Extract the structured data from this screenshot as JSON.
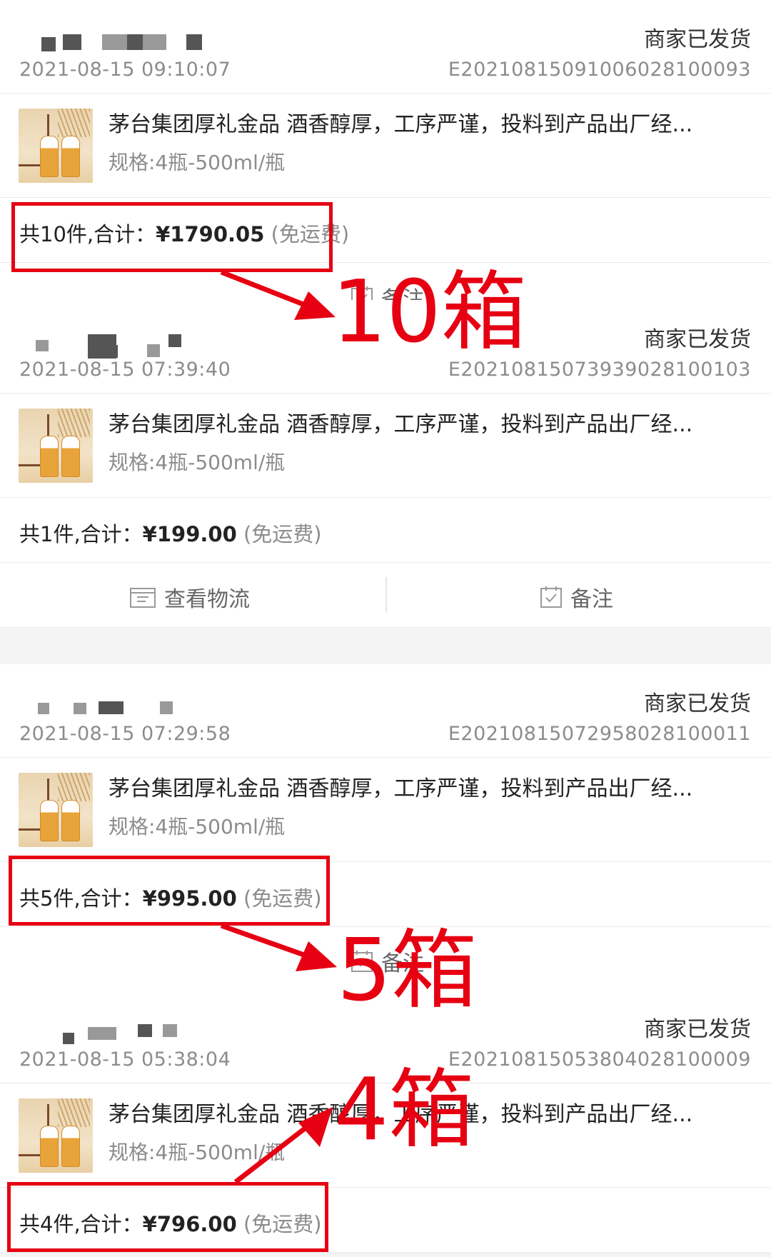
{
  "orders": [
    {
      "time": "2021-08-15 09:10:07",
      "status": "商家已发货",
      "order_no": "E20210815091006028100093",
      "product_title": "茅台集团厚礼金品 酒香醇厚，工序严谨，投料到产品出厂经...",
      "spec": "规格:4瓶-500ml/瓶",
      "total_prefix": "共10件,合计：",
      "amount": "¥1790.05",
      "shipping": "(免运费)",
      "action_note_label": "备注"
    },
    {
      "time": "2021-08-15 07:39:40",
      "status": "商家已发货",
      "order_no": "E20210815073939028100103",
      "product_title": "茅台集团厚礼金品 酒香醇厚，工序严谨，投料到产品出厂经...",
      "spec": "规格:4瓶-500ml/瓶",
      "total_prefix": "共1件,合计：",
      "amount": "¥199.00",
      "shipping": "(免运费)",
      "action_logistics_label": "查看物流",
      "action_note_label": "备注"
    },
    {
      "time": "2021-08-15 07:29:58",
      "status": "商家已发货",
      "order_no": "E20210815072958028100011",
      "product_title": "茅台集团厚礼金品 酒香醇厚，工序严谨，投料到产品出厂经...",
      "spec": "规格:4瓶-500ml/瓶",
      "total_prefix": "共5件,合计：",
      "amount": "¥995.00",
      "shipping": "(免运费)",
      "action_note_label": "备注"
    },
    {
      "time": "2021-08-15 05:38:04",
      "status": "商家已发货",
      "order_no": "E20210815053804028100009",
      "product_title": "茅台集团厚礼金品 酒香醇厚，工序严谨，投料到产品出厂经...",
      "spec": "规格:4瓶-500ml/瓶",
      "total_prefix": "共4件,合计：",
      "amount": "¥796.00",
      "shipping": "(免运费)"
    }
  ],
  "annotations": {
    "label_1": "10箱",
    "label_2": "5箱",
    "label_3": "4箱",
    "color": "#e60012"
  },
  "icons": [
    "logistics-icon",
    "note-icon",
    "product-thumbnail"
  ]
}
